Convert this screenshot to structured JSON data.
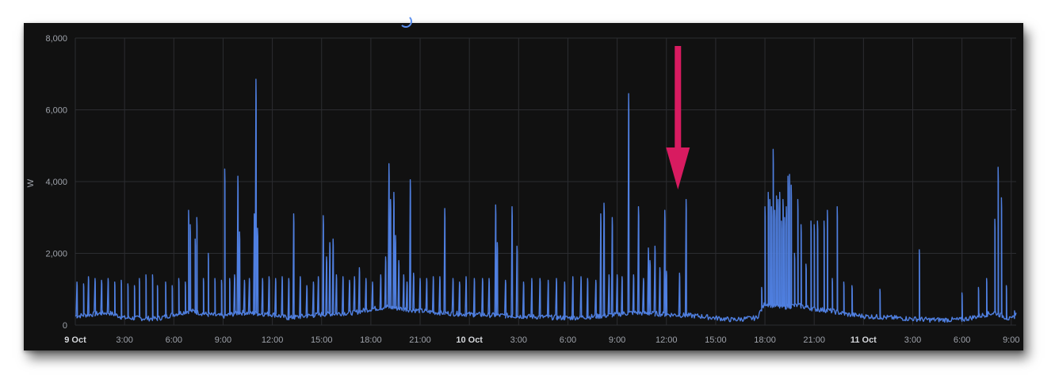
{
  "chart_data": {
    "type": "line",
    "title": "",
    "ylabel": "W",
    "xlabel": "",
    "ylim": [
      0,
      8000
    ],
    "y_ticks": [
      "0",
      "2,000",
      "4,000",
      "6,000",
      "8,000"
    ],
    "y_tick_values": [
      0,
      2000,
      4000,
      6000,
      8000
    ],
    "x_ticks": [
      {
        "label": "9 Oct",
        "hour": 0,
        "major": true
      },
      {
        "label": "3:00",
        "hour": 3,
        "major": false
      },
      {
        "label": "6:00",
        "hour": 6,
        "major": false
      },
      {
        "label": "9:00",
        "hour": 9,
        "major": false
      },
      {
        "label": "12:00",
        "hour": 12,
        "major": false
      },
      {
        "label": "15:00",
        "hour": 15,
        "major": false
      },
      {
        "label": "18:00",
        "hour": 18,
        "major": false
      },
      {
        "label": "21:00",
        "hour": 21,
        "major": false
      },
      {
        "label": "10 Oct",
        "hour": 24,
        "major": true
      },
      {
        "label": "3:00",
        "hour": 27,
        "major": false
      },
      {
        "label": "6:00",
        "hour": 30,
        "major": false
      },
      {
        "label": "9:00",
        "hour": 33,
        "major": false
      },
      {
        "label": "12:00",
        "hour": 36,
        "major": false
      },
      {
        "label": "15:00",
        "hour": 39,
        "major": false
      },
      {
        "label": "18:00",
        "hour": 42,
        "major": false
      },
      {
        "label": "21:00",
        "hour": 45,
        "major": false
      },
      {
        "label": "11 Oct",
        "hour": 48,
        "major": true
      },
      {
        "label": "3:00",
        "hour": 51,
        "major": false
      },
      {
        "label": "6:00",
        "hour": 54,
        "major": false
      },
      {
        "label": "9:00",
        "hour": 57,
        "major": false
      }
    ],
    "x_range_hours": [
      0,
      57.3
    ],
    "grid": true,
    "series": [
      {
        "color": "#4f7fe0",
        "baseline_segments": [
          [
            0,
            250
          ],
          [
            2,
            350
          ],
          [
            3,
            200
          ],
          [
            5,
            180
          ],
          [
            6,
            300
          ],
          [
            7,
            400
          ],
          [
            8,
            300
          ],
          [
            9,
            250
          ],
          [
            10,
            350
          ],
          [
            12,
            300
          ],
          [
            13,
            200
          ],
          [
            15,
            300
          ],
          [
            17,
            350
          ],
          [
            18,
            450
          ],
          [
            19,
            500
          ],
          [
            20,
            450
          ],
          [
            21,
            400
          ],
          [
            22,
            350
          ],
          [
            24,
            300
          ],
          [
            27,
            250
          ],
          [
            30,
            200
          ],
          [
            32,
            250
          ],
          [
            34,
            350
          ],
          [
            36,
            300
          ],
          [
            38,
            250
          ],
          [
            40,
            150
          ],
          [
            41.5,
            200
          ],
          [
            42,
            600
          ],
          [
            43,
            500
          ],
          [
            44,
            550
          ],
          [
            45,
            450
          ],
          [
            46,
            400
          ],
          [
            47,
            300
          ],
          [
            48,
            250
          ],
          [
            50,
            200
          ],
          [
            52,
            150
          ],
          [
            54,
            150
          ],
          [
            55,
            250
          ],
          [
            56,
            350
          ],
          [
            57,
            150
          ],
          [
            57.3,
            300
          ]
        ],
        "spikes": [
          [
            0.1,
            1200
          ],
          [
            0.5,
            1150
          ],
          [
            0.8,
            1350
          ],
          [
            1.2,
            1300
          ],
          [
            1.6,
            1250
          ],
          [
            2.0,
            1300
          ],
          [
            2.4,
            1200
          ],
          [
            2.8,
            1250
          ],
          [
            3.2,
            1150
          ],
          [
            3.6,
            1100
          ],
          [
            3.9,
            1300
          ],
          [
            4.3,
            1400
          ],
          [
            4.7,
            1400
          ],
          [
            5.0,
            1100
          ],
          [
            5.5,
            1200
          ],
          [
            5.9,
            1100
          ],
          [
            6.3,
            1300
          ],
          [
            6.7,
            1200
          ],
          [
            6.9,
            3200
          ],
          [
            7.0,
            2800
          ],
          [
            7.3,
            2400
          ],
          [
            7.4,
            3000
          ],
          [
            7.8,
            1300
          ],
          [
            8.1,
            2000
          ],
          [
            8.5,
            1300
          ],
          [
            8.9,
            1250
          ],
          [
            9.1,
            4350
          ],
          [
            9.4,
            1300
          ],
          [
            9.7,
            1400
          ],
          [
            9.9,
            4150
          ],
          [
            10.0,
            2600
          ],
          [
            10.3,
            1250
          ],
          [
            10.6,
            1300
          ],
          [
            10.9,
            3100
          ],
          [
            11.0,
            6850
          ],
          [
            11.1,
            2700
          ],
          [
            11.4,
            1300
          ],
          [
            11.8,
            1350
          ],
          [
            12.2,
            1300
          ],
          [
            12.6,
            1350
          ],
          [
            13.0,
            1300
          ],
          [
            13.3,
            3100
          ],
          [
            13.7,
            1350
          ],
          [
            14.1,
            1100
          ],
          [
            14.5,
            1200
          ],
          [
            14.8,
            1350
          ],
          [
            15.1,
            3050
          ],
          [
            15.3,
            1900
          ],
          [
            15.5,
            2300
          ],
          [
            15.7,
            2400
          ],
          [
            15.9,
            1400
          ],
          [
            16.3,
            1350
          ],
          [
            16.7,
            1250
          ],
          [
            17.0,
            1350
          ],
          [
            17.3,
            1600
          ],
          [
            17.7,
            1300
          ],
          [
            18.1,
            1200
          ],
          [
            18.6,
            1400
          ],
          [
            18.9,
            1900
          ],
          [
            19.1,
            4500
          ],
          [
            19.2,
            3500
          ],
          [
            19.4,
            3700
          ],
          [
            19.5,
            2500
          ],
          [
            19.7,
            1800
          ],
          [
            20.0,
            1400
          ],
          [
            20.2,
            1200
          ],
          [
            20.4,
            4050
          ],
          [
            20.6,
            1450
          ],
          [
            21.0,
            1300
          ],
          [
            21.4,
            1300
          ],
          [
            21.8,
            1350
          ],
          [
            22.2,
            1350
          ],
          [
            22.5,
            3250
          ],
          [
            23.0,
            1300
          ],
          [
            23.4,
            1200
          ],
          [
            23.8,
            1350
          ],
          [
            24.3,
            1300
          ],
          [
            24.8,
            1300
          ],
          [
            25.2,
            1300
          ],
          [
            25.6,
            3350
          ],
          [
            25.7,
            2300
          ],
          [
            26.2,
            1250
          ],
          [
            26.6,
            3300
          ],
          [
            26.9,
            2200
          ],
          [
            27.3,
            1200
          ],
          [
            27.8,
            1300
          ],
          [
            28.3,
            1300
          ],
          [
            28.8,
            1250
          ],
          [
            29.3,
            1300
          ],
          [
            29.8,
            1200
          ],
          [
            30.3,
            1350
          ],
          [
            30.8,
            1350
          ],
          [
            31.2,
            1300
          ],
          [
            31.7,
            1250
          ],
          [
            32.0,
            3100
          ],
          [
            32.2,
            3400
          ],
          [
            32.5,
            1400
          ],
          [
            32.7,
            3000
          ],
          [
            33.0,
            1400
          ],
          [
            33.3,
            1350
          ],
          [
            33.7,
            6450
          ],
          [
            34.0,
            1400
          ],
          [
            34.3,
            3300
          ],
          [
            34.6,
            1300
          ],
          [
            34.9,
            2150
          ],
          [
            35.0,
            1800
          ],
          [
            35.3,
            2200
          ],
          [
            35.6,
            1600
          ],
          [
            35.9,
            3200
          ],
          [
            36.0,
            1500
          ],
          [
            36.8,
            1450
          ],
          [
            37.2,
            3500
          ],
          [
            41.8,
            1050
          ],
          [
            42.0,
            3300
          ],
          [
            42.2,
            3700
          ],
          [
            42.3,
            3500
          ],
          [
            42.4,
            3300
          ],
          [
            42.5,
            4900
          ],
          [
            42.6,
            3200
          ],
          [
            42.7,
            3600
          ],
          [
            42.8,
            3500
          ],
          [
            42.9,
            3700
          ],
          [
            43.0,
            2900
          ],
          [
            43.1,
            3500
          ],
          [
            43.2,
            3000
          ],
          [
            43.3,
            3300
          ],
          [
            43.4,
            4150
          ],
          [
            43.5,
            4200
          ],
          [
            43.6,
            3900
          ],
          [
            43.8,
            2000
          ],
          [
            44.0,
            3500
          ],
          [
            44.2,
            2800
          ],
          [
            44.5,
            1700
          ],
          [
            44.8,
            2900
          ],
          [
            45.0,
            2800
          ],
          [
            45.2,
            2900
          ],
          [
            45.6,
            2900
          ],
          [
            45.8,
            3200
          ],
          [
            46.1,
            1300
          ],
          [
            46.4,
            3300
          ],
          [
            46.8,
            1200
          ],
          [
            47.3,
            1100
          ],
          [
            49.0,
            1000
          ],
          [
            51.4,
            2100
          ],
          [
            54.0,
            900
          ],
          [
            55.0,
            1050
          ],
          [
            55.5,
            1300
          ],
          [
            56.0,
            2950
          ],
          [
            56.2,
            4400
          ],
          [
            56.4,
            3550
          ],
          [
            56.7,
            1100
          ],
          [
            57.2,
            400
          ]
        ]
      }
    ],
    "annotation": {
      "type": "arrow",
      "color": "#d81b60",
      "points_to_hour": 36.7
    }
  }
}
